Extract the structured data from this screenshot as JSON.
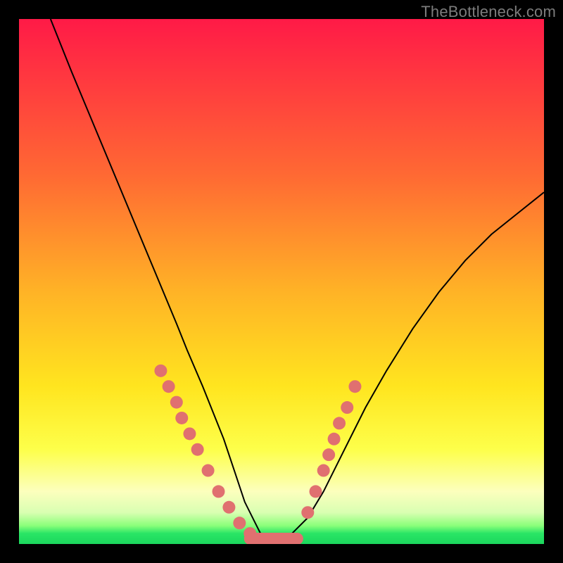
{
  "watermark": "TheBottleneck.com",
  "chart_data": {
    "type": "line",
    "title": "",
    "xlabel": "",
    "ylabel": "",
    "xlim": [
      0,
      100
    ],
    "ylim": [
      0,
      100
    ],
    "grid": false,
    "legend": false,
    "series": [
      {
        "name": "bottleneck-curve",
        "x": [
          6,
          10,
          15,
          20,
          25,
          30,
          32,
          35,
          37,
          39,
          41,
          43,
          45,
          46,
          48,
          50,
          52,
          55,
          58,
          62,
          66,
          70,
          75,
          80,
          85,
          90,
          95,
          100
        ],
        "y": [
          100,
          90,
          78,
          66,
          54,
          42,
          37,
          30,
          25,
          20,
          14,
          8,
          4,
          2,
          1,
          1,
          2,
          5,
          10,
          18,
          26,
          33,
          41,
          48,
          54,
          59,
          63,
          67
        ]
      }
    ],
    "markers": {
      "name": "highlight-points",
      "color": "#e07070",
      "x": [
        27,
        28.5,
        30,
        31,
        32.5,
        34,
        36,
        38,
        40,
        42,
        44,
        55,
        56.5,
        58,
        59,
        60,
        61,
        62.5,
        64
      ],
      "y": [
        33,
        30,
        27,
        24,
        21,
        18,
        14,
        10,
        7,
        4,
        2,
        6,
        10,
        14,
        17,
        20,
        23,
        26,
        30
      ]
    },
    "bottom_segment": {
      "name": "optimal-range",
      "color": "#e07070",
      "x_start": 44,
      "x_end": 53,
      "y": 1
    },
    "background_gradient": {
      "top": "#ff1a47",
      "mid_upper": "#ff6a33",
      "mid": "#ffe51f",
      "mid_lower": "#fcffbd",
      "bottom": "#1cd75d"
    }
  }
}
